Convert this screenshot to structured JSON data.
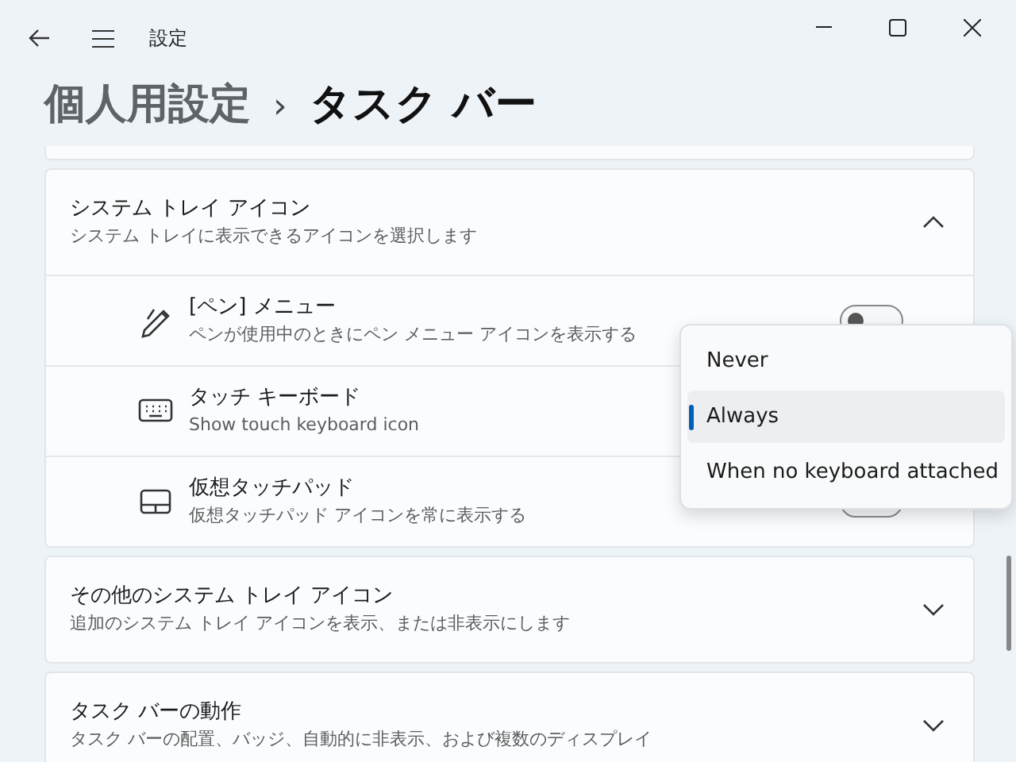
{
  "window": {
    "title": "設定"
  },
  "breadcrumb": {
    "parent": "個人用設定",
    "separator": "›",
    "current": "タスク バー"
  },
  "sections": [
    {
      "title": "システム トレイ アイコン",
      "subtitle": "システム トレイに表示できるアイコンを選択します",
      "expanded": true,
      "items": [
        {
          "kind": "pen",
          "title": "[ペン] メニュー",
          "subtitle": "ペンが使用中のときにペン メニュー アイコンを表示する",
          "on": false
        },
        {
          "kind": "keyboard",
          "title": "タッチ キーボード",
          "subtitle": "Show touch keyboard icon"
        },
        {
          "kind": "touchpad",
          "title": "仮想タッチパッド",
          "subtitle": "仮想タッチパッド アイコンを常に表示する",
          "on": false
        }
      ]
    },
    {
      "title": "その他のシステム トレイ アイコン",
      "subtitle": "追加のシステム トレイ アイコンを表示、または非表示にします",
      "expanded": false
    },
    {
      "title": "タスク バーの動作",
      "subtitle": "タスク バーの配置、バッジ、自動的に非表示、および複数のディスプレイ",
      "expanded": false
    }
  ],
  "dropdown_menu": {
    "options": [
      {
        "label": "Never",
        "selected": false
      },
      {
        "label": "Always",
        "selected": true
      },
      {
        "label": "When no keyboard attached",
        "selected": false
      }
    ]
  }
}
